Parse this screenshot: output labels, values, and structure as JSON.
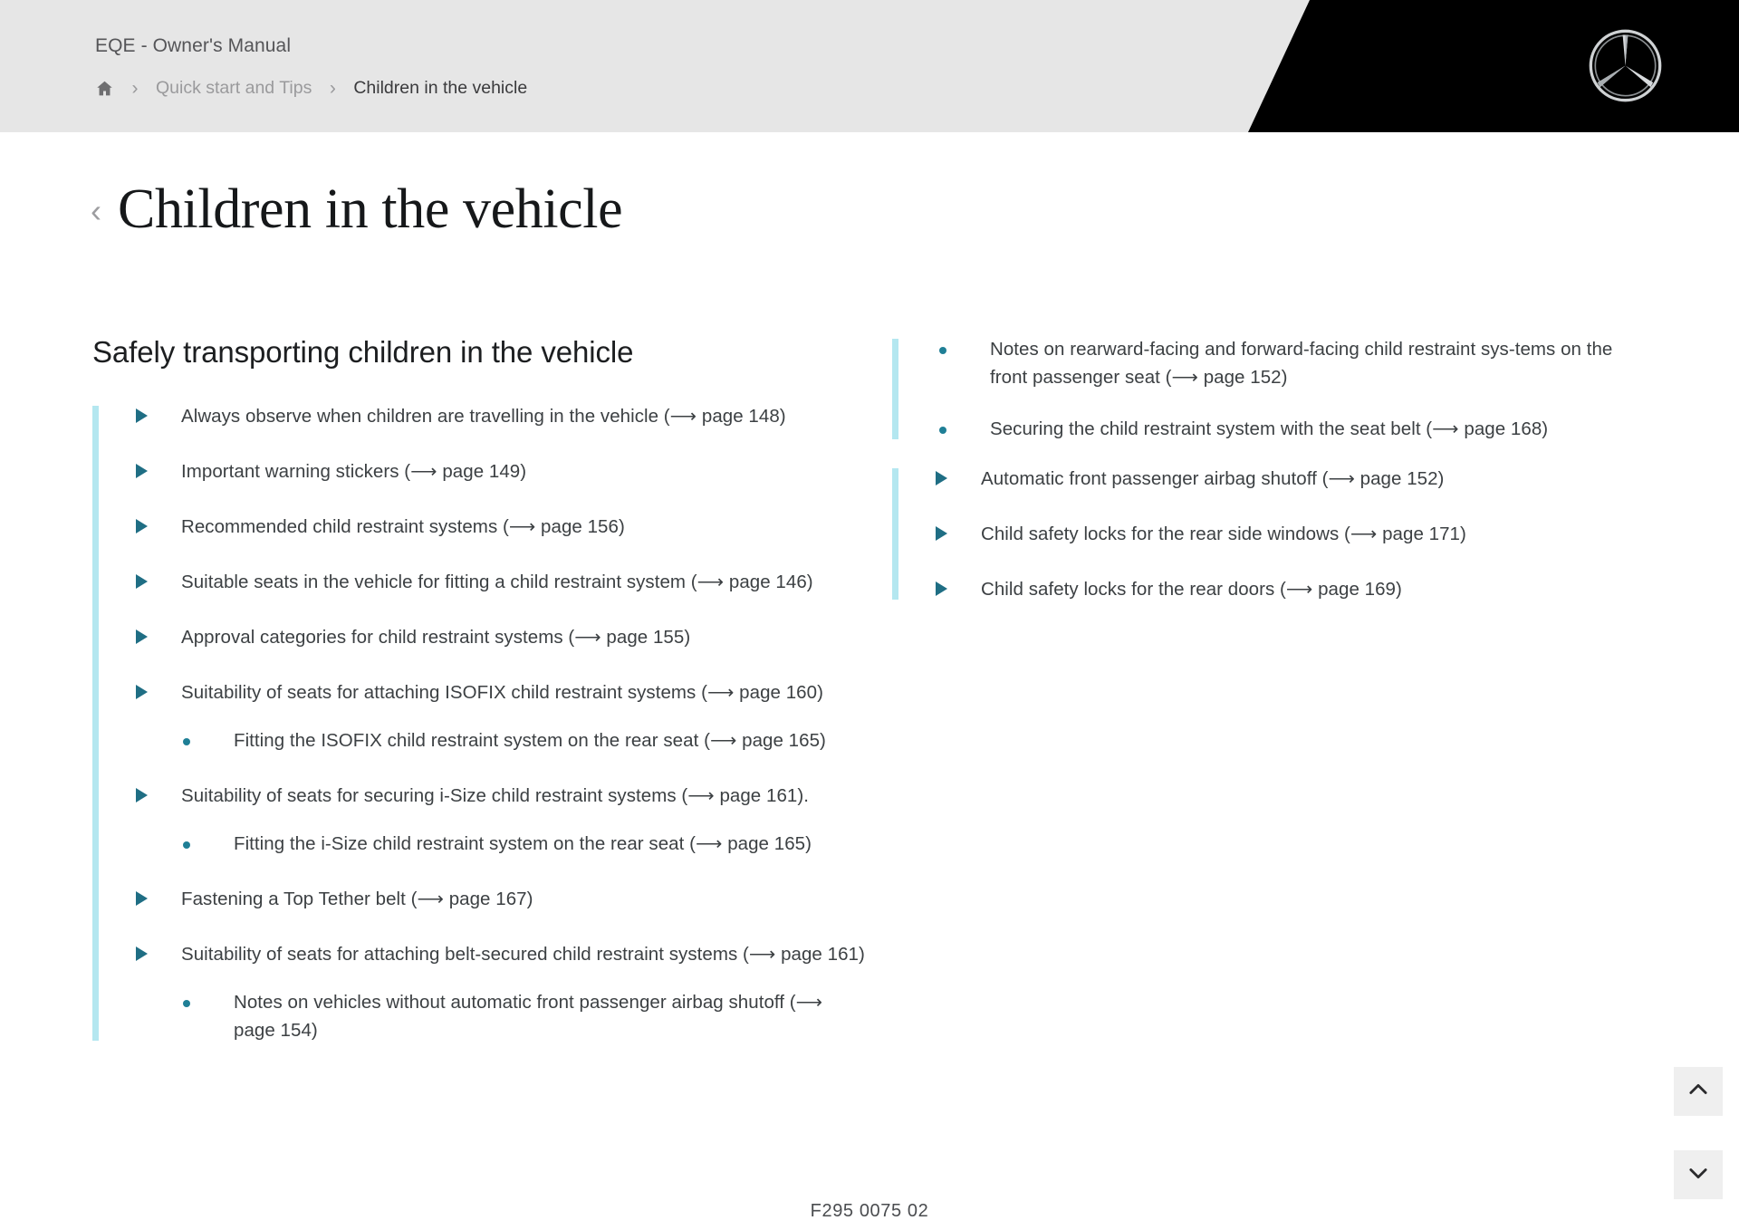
{
  "header": {
    "manual_title": "EQE - Owner's Manual",
    "breadcrumb": {
      "home_icon": "home-icon",
      "separator": "›",
      "items": [
        {
          "label": "Quick start and Tips",
          "current": false
        },
        {
          "label": "Children in the vehicle",
          "current": true
        }
      ]
    },
    "logo_name": "mercedes-benz-star-logo",
    "background_color": "#e6e6e6",
    "accent_block_color": "#000000"
  },
  "title": {
    "back_icon": "chevron-left-icon",
    "back_glyph": "‹",
    "text": "Children in the vehicle"
  },
  "colors": {
    "accent_bar": "#b4e7f0",
    "bullet_triangle": "#1f6e84",
    "bullet_dot": "#1f7f96",
    "body_text": "#3c4043"
  },
  "left_column": {
    "section_heading": "Safely transporting children in the vehicle",
    "items": [
      {
        "text": "Always observe when children are travelling in the vehicle (⟶ page 148)",
        "subitems": []
      },
      {
        "text": "Important warning stickers (⟶ page 149)",
        "subitems": []
      },
      {
        "text": "Recommended child restraint systems (⟶ page 156)",
        "subitems": []
      },
      {
        "text": "Suitable seats in the vehicle for fitting a child restraint system (⟶ page 146)",
        "subitems": []
      },
      {
        "text": "Approval categories for child restraint systems (⟶ page 155)",
        "subitems": []
      },
      {
        "text": "Suitability of seats for attaching ISOFIX child restraint systems (⟶ page 160)",
        "subitems": [
          {
            "text": "Fitting the ISOFIX child restraint system on the rear seat (⟶ page 165)"
          }
        ]
      },
      {
        "text": "Suitability of seats for securing i-Size child restraint systems (⟶ page 161).",
        "subitems": [
          {
            "text": "Fitting the i-Size child restraint system on the rear seat (⟶ page 165)"
          }
        ]
      },
      {
        "text": "Fastening a Top Tether belt (⟶ page 167)",
        "subitems": []
      },
      {
        "text": "Suitability of seats for attaching belt-secured child restraint systems (⟶ page 161)",
        "subitems": [
          {
            "text": "Notes on vehicles without automatic front passenger airbag shutoff (⟶ page 154)"
          }
        ]
      }
    ]
  },
  "right_column": {
    "continued_subitems": [
      {
        "text": "Notes on rearward-facing and forward-facing child restraint sys-tems on the front passenger seat (⟶ page 152)"
      },
      {
        "text": "Securing the child restraint system with the seat belt (⟶ page 168)"
      }
    ],
    "items": [
      {
        "text": "Automatic front passenger airbag shutoff (⟶ page 152)",
        "subitems": []
      },
      {
        "text": "Child safety locks for the rear side windows (⟶ page 171)",
        "subitems": []
      },
      {
        "text": "Child safety locks for the rear doors (⟶ page 169)",
        "subitems": []
      }
    ]
  },
  "footer": {
    "document_code": "F295 0075 02"
  },
  "floating_buttons": [
    {
      "name": "scroll-to-top-button",
      "icon": "chevron-up-icon"
    },
    {
      "name": "collapse-button",
      "icon": "chevron-down-icon"
    }
  ]
}
